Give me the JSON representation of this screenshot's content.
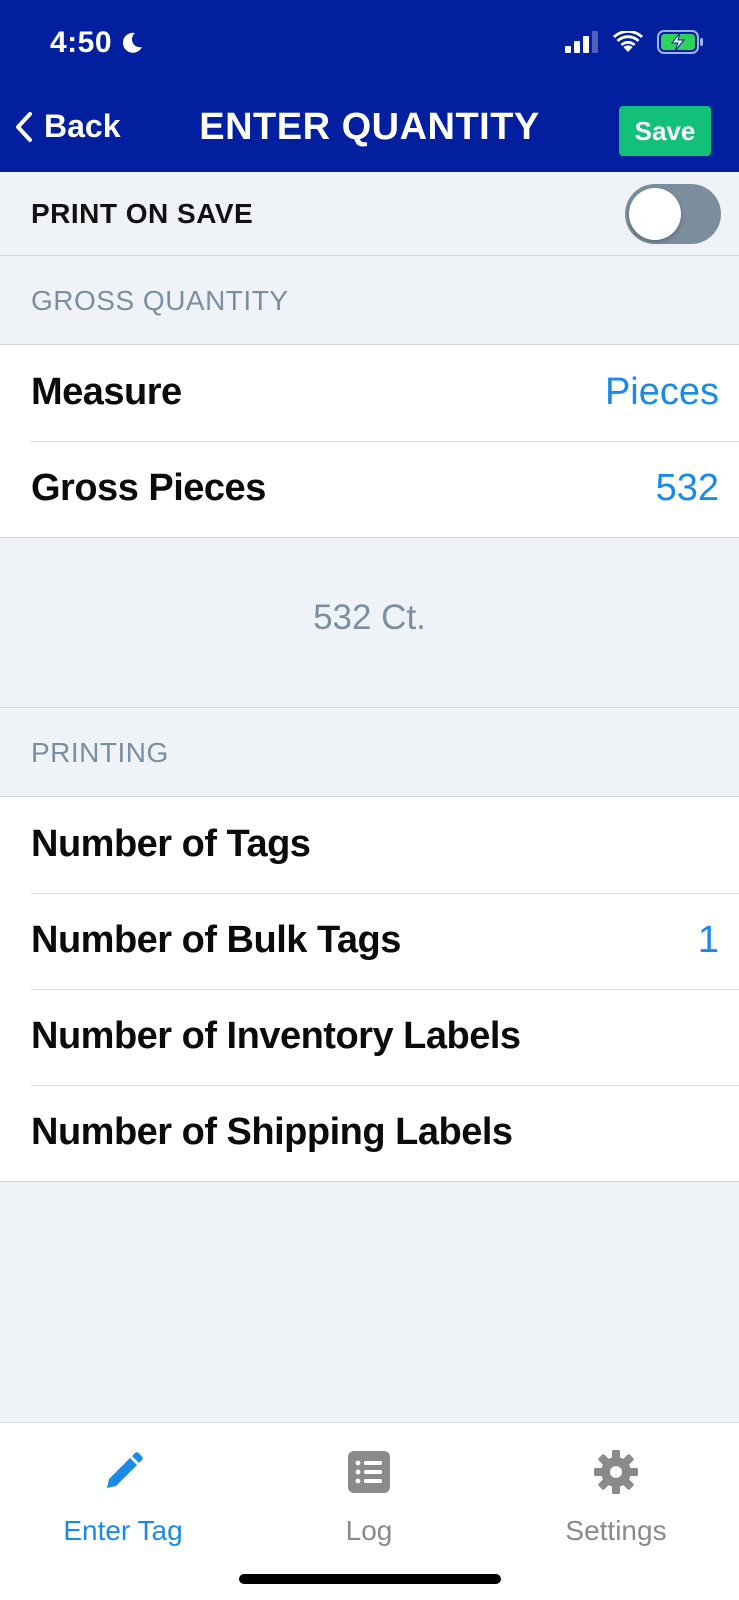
{
  "status_bar": {
    "time": "4:50"
  },
  "nav": {
    "back_label": "Back",
    "title": "ENTER QUANTITY",
    "save_label": "Save"
  },
  "print_on_save": {
    "label": "PRINT ON SAVE",
    "enabled": false
  },
  "gross_quantity": {
    "header": "GROSS QUANTITY",
    "rows": [
      {
        "label": "Measure",
        "value": "Pieces"
      },
      {
        "label": "Gross Pieces",
        "value": "532"
      }
    ],
    "summary": "532 Ct."
  },
  "printing": {
    "header": "PRINTING",
    "rows": [
      {
        "label": "Number of Tags",
        "value": ""
      },
      {
        "label": "Number of Bulk Tags",
        "value": "1"
      },
      {
        "label": "Number of Inventory Labels",
        "value": ""
      },
      {
        "label": "Number of Shipping Labels",
        "value": ""
      }
    ]
  },
  "tabs": [
    {
      "label": "Enter Tag",
      "icon": "pencil-icon",
      "active": true
    },
    {
      "label": "Log",
      "icon": "list-icon",
      "active": false
    },
    {
      "label": "Settings",
      "icon": "gear-icon",
      "active": false
    }
  ],
  "colors": {
    "header": "#011f9e",
    "save": "#12c07a",
    "accent": "#1b8ae6",
    "muted": "#7b8fa3"
  }
}
